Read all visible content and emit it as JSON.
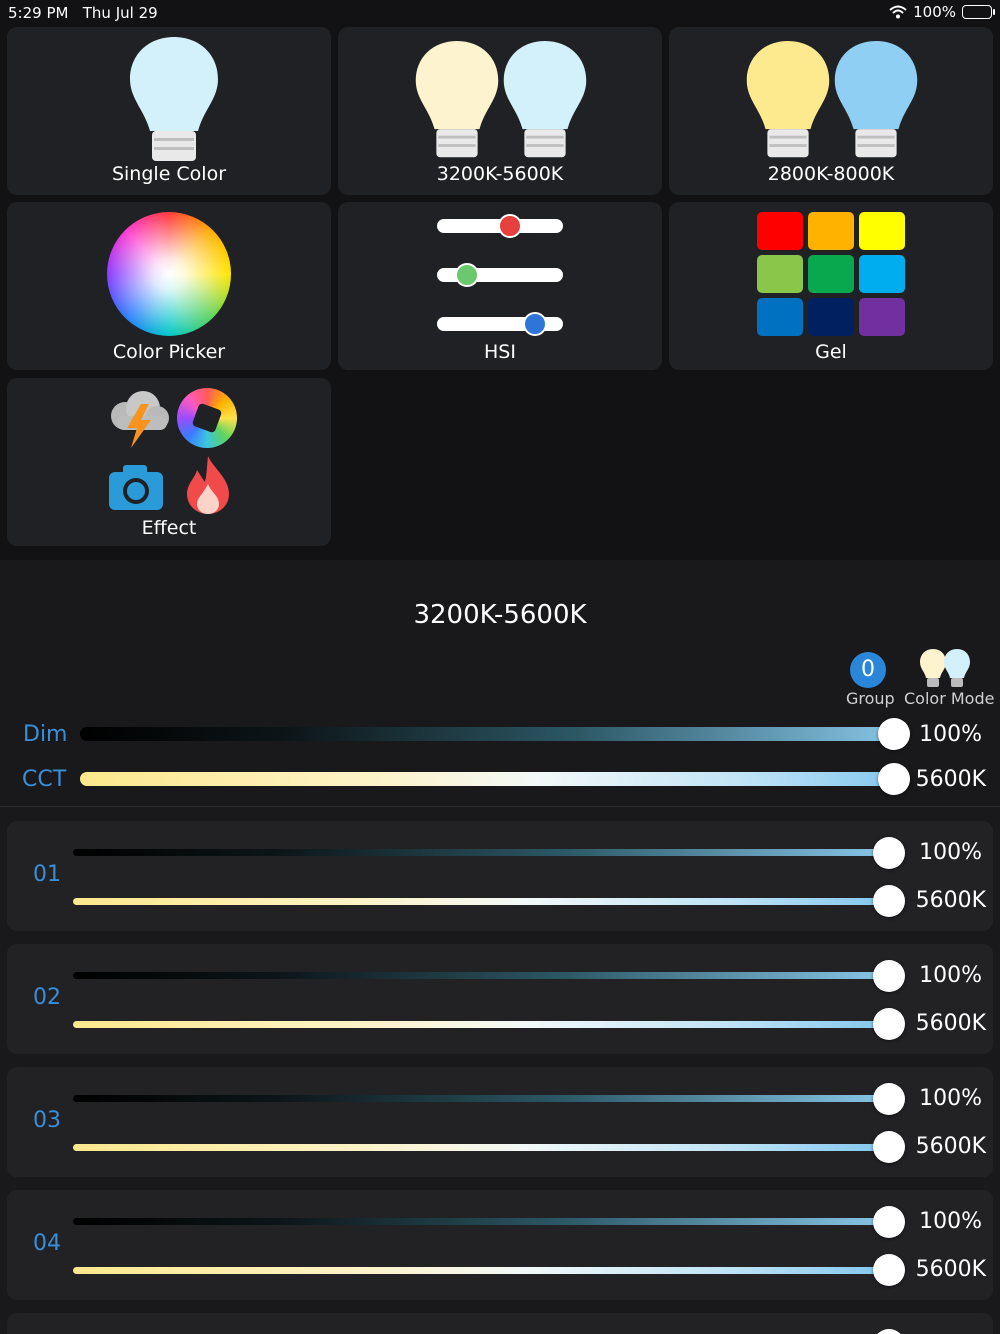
{
  "status": {
    "time": "5:29 PM",
    "date": "Thu Jul 29",
    "battery": "100%"
  },
  "tiles": {
    "single_color": "Single Color",
    "range_3200_5600": "3200K-5600K",
    "range_2800_8000": "2800K-8000K",
    "color_picker": "Color Picker",
    "hsi": "HSI",
    "gel": "Gel",
    "effect": "Effect"
  },
  "gel_colors": [
    "#ff0000",
    "#ffb300",
    "#ffff00",
    "#8ac64a",
    "#0aa84e",
    "#00aeef",
    "#0070c0",
    "#002060",
    "#7030a0"
  ],
  "hsi_levels": {
    "hue": 0.6,
    "saturation": 0.18,
    "intensity": 0.84
  },
  "panel": {
    "title": "3200K-5600K",
    "group_number": "0",
    "group_label": "Group",
    "color_mode_label": "Color Mode"
  },
  "master": {
    "dim_label": "Dim",
    "dim_value": "100%",
    "dim_level": 1.0,
    "cct_label": "CCT",
    "cct_value": "5600K",
    "cct_level": 1.0
  },
  "rows": [
    {
      "id": "01",
      "dim_value": "100%",
      "cct_value": "5600K"
    },
    {
      "id": "02",
      "dim_value": "100%",
      "cct_value": "5600K"
    },
    {
      "id": "03",
      "dim_value": "100%",
      "cct_value": "5600K"
    },
    {
      "id": "04",
      "dim_value": "100%",
      "cct_value": "5600K"
    }
  ]
}
